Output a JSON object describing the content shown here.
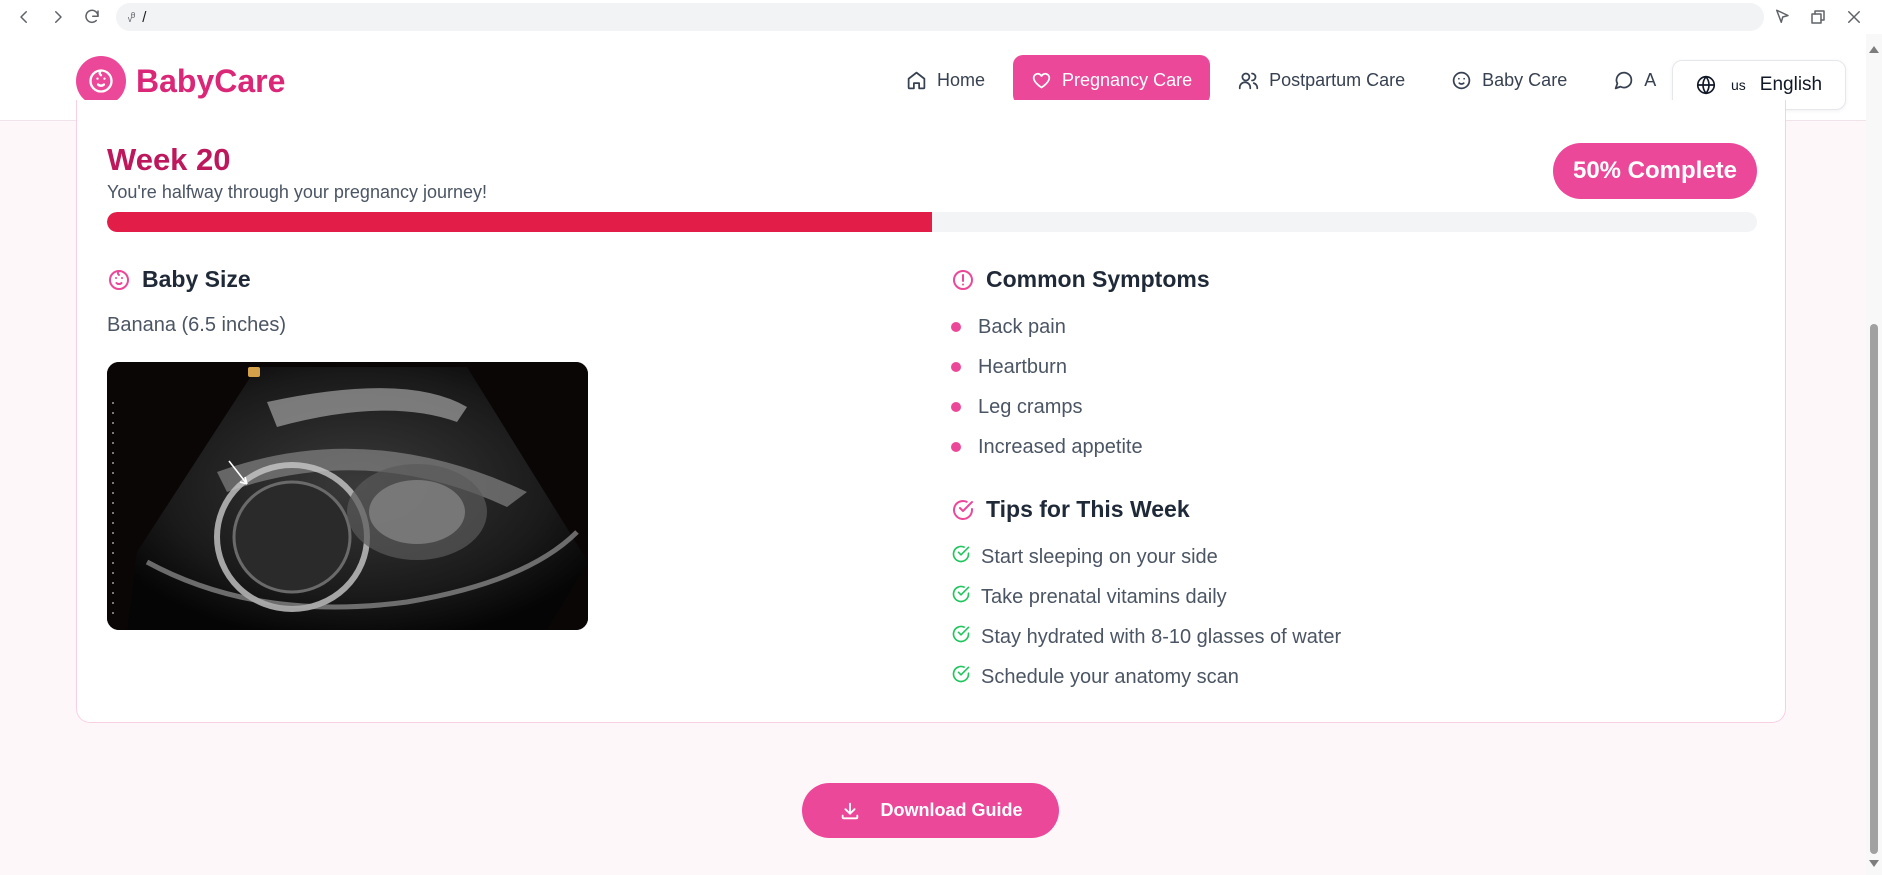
{
  "browser": {
    "address": "/",
    "site_icon": "ᵥᶿ"
  },
  "header": {
    "brand": "BabyCare",
    "nav": [
      {
        "label": "Home",
        "icon": "home-icon"
      },
      {
        "label": "Pregnancy Care",
        "icon": "heart-icon"
      },
      {
        "label": "Postpartum Care",
        "icon": "users-icon"
      },
      {
        "label": "Baby Care",
        "icon": "baby-icon"
      },
      {
        "label": "A",
        "icon": "chat-icon"
      }
    ],
    "language": {
      "flag": "us",
      "name": "English"
    }
  },
  "week": {
    "title": "Week 20",
    "subtitle": "You're halfway through your pregnancy journey!",
    "complete_label": "50% Complete",
    "progress": 0.5
  },
  "baby_size": {
    "heading": "Baby Size",
    "value": "Banana (6.5 inches)"
  },
  "symptoms": {
    "heading": "Common Symptoms",
    "items": [
      "Back pain",
      "Heartburn",
      "Leg cramps",
      "Increased appetite"
    ]
  },
  "tips": {
    "heading": "Tips for This Week",
    "items": [
      "Start sleeping on your side",
      "Take prenatal vitamins daily",
      "Stay hydrated with 8-10 glasses of water",
      "Schedule your anatomy scan"
    ]
  },
  "download": {
    "label": "Download Guide"
  },
  "colors": {
    "accent": "#ec4899",
    "brand_text": "#db2777",
    "progress": "#e11d48",
    "check": "#22c55e"
  }
}
